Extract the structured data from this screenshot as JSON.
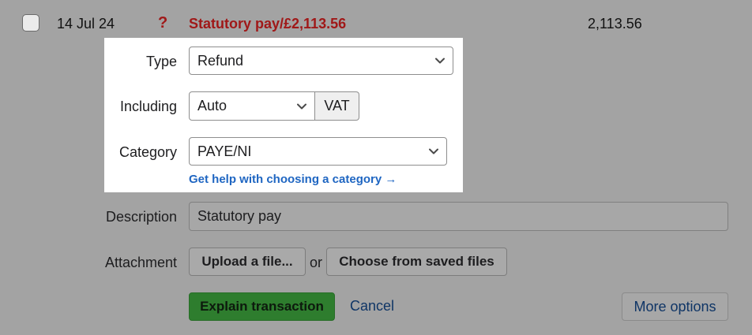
{
  "transaction": {
    "date": "14 Jul 24",
    "unexplained_marker": "?",
    "title": "Statutory pay/£2,113.56",
    "amount": "2,113.56"
  },
  "form": {
    "type": {
      "label": "Type",
      "value": "Refund"
    },
    "including": {
      "label": "Including",
      "value": "Auto",
      "suffix": "VAT"
    },
    "category": {
      "label": "Category",
      "value": "PAYE/NI",
      "help_link": "Get help with choosing a category →"
    },
    "description": {
      "label": "Description",
      "value": "Statutory pay"
    },
    "attachment": {
      "label": "Attachment",
      "upload_label": "Upload a file...",
      "or_text": "or",
      "saved_label": "Choose from saved files"
    }
  },
  "actions": {
    "explain_label": "Explain transaction",
    "cancel_label": "Cancel",
    "more_label": "More options"
  },
  "colors": {
    "overlay": "#a3a3a3",
    "panel": "#ffffff",
    "link": "#1f66c2",
    "primary": "#2e7d2e",
    "unexplained": "#a01818"
  },
  "icons": {
    "select_arrow": "chevron-down-icon"
  }
}
